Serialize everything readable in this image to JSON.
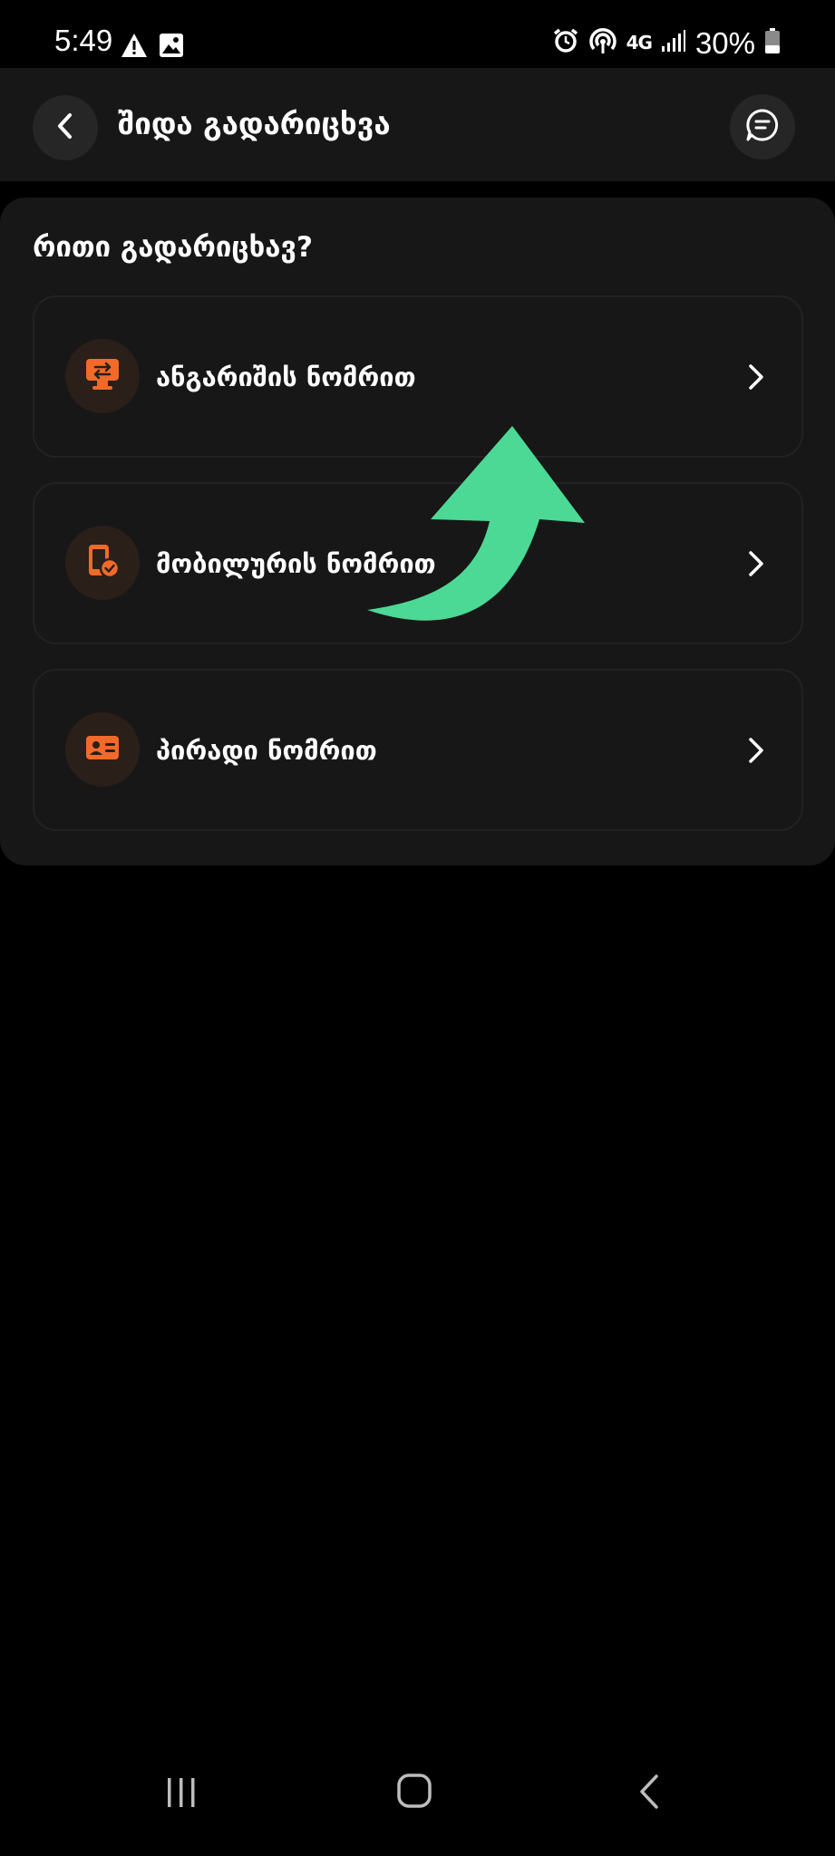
{
  "status_bar": {
    "time": "5:49",
    "network": "4G",
    "battery": "30%",
    "icons": [
      "warning-icon",
      "image-icon",
      "alarm-icon",
      "hotspot-icon",
      "signal-icon",
      "battery-icon"
    ]
  },
  "header": {
    "title": "შიდა გადარიცხვა",
    "icons": [
      "chevron-left-icon",
      "chat-icon"
    ]
  },
  "main": {
    "section_title": "რითი გადარიცხავ?",
    "options": [
      {
        "label": "ანგარიშის ნომრით",
        "icon": "account-transfer-icon"
      },
      {
        "label": "მობილურის ნომრით",
        "icon": "mobile-check-icon"
      },
      {
        "label": "პირადი ნომრით",
        "icon": "id-card-icon"
      }
    ]
  },
  "overlay": {
    "icon": "curved-arrow-icon",
    "color": "#4cd995"
  },
  "colors": {
    "background": "#000000",
    "surface": "#171717",
    "accent": "#f26a2a",
    "icon_bg": "#2a1f19"
  },
  "nav": {
    "icons": [
      "recents-icon",
      "home-icon",
      "back-icon"
    ]
  }
}
